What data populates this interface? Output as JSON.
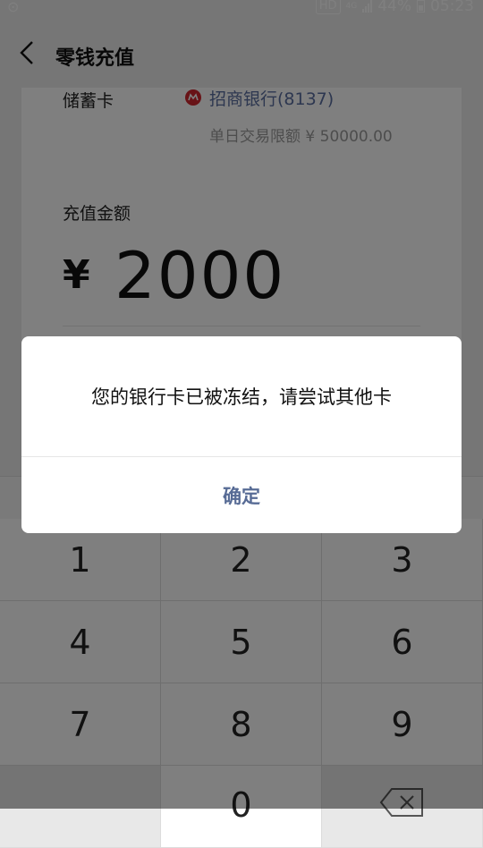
{
  "status_bar": {
    "left_icon": "location-icon",
    "hd": "HD",
    "network": "4G",
    "battery": "44%",
    "time": "05:23"
  },
  "nav": {
    "back_icon": "chevron-left-icon",
    "title": "零钱充值"
  },
  "card": {
    "card_type_label": "储蓄卡",
    "bank_icon": "cmb-bank-icon",
    "bank_name": "招商银行(8137)",
    "daily_limit": "单日交易限额 ¥ 50000.00",
    "amount_label": "充值金额",
    "currency_symbol": "¥",
    "amount": "2000"
  },
  "keypad": {
    "keys": [
      "1",
      "2",
      "3",
      "4",
      "5",
      "6",
      "7",
      "8",
      "9",
      "",
      "0",
      ""
    ],
    "delete_icon": "backspace-icon"
  },
  "dialog": {
    "message": "您的银行卡已被冻结，请尝试其他卡",
    "confirm_label": "确定"
  },
  "colors": {
    "link_blue": "#576b95",
    "bank_text": "#5b6ea0",
    "bank_red": "#d0272e",
    "overlay": "rgba(0,0,0,0.5)"
  }
}
